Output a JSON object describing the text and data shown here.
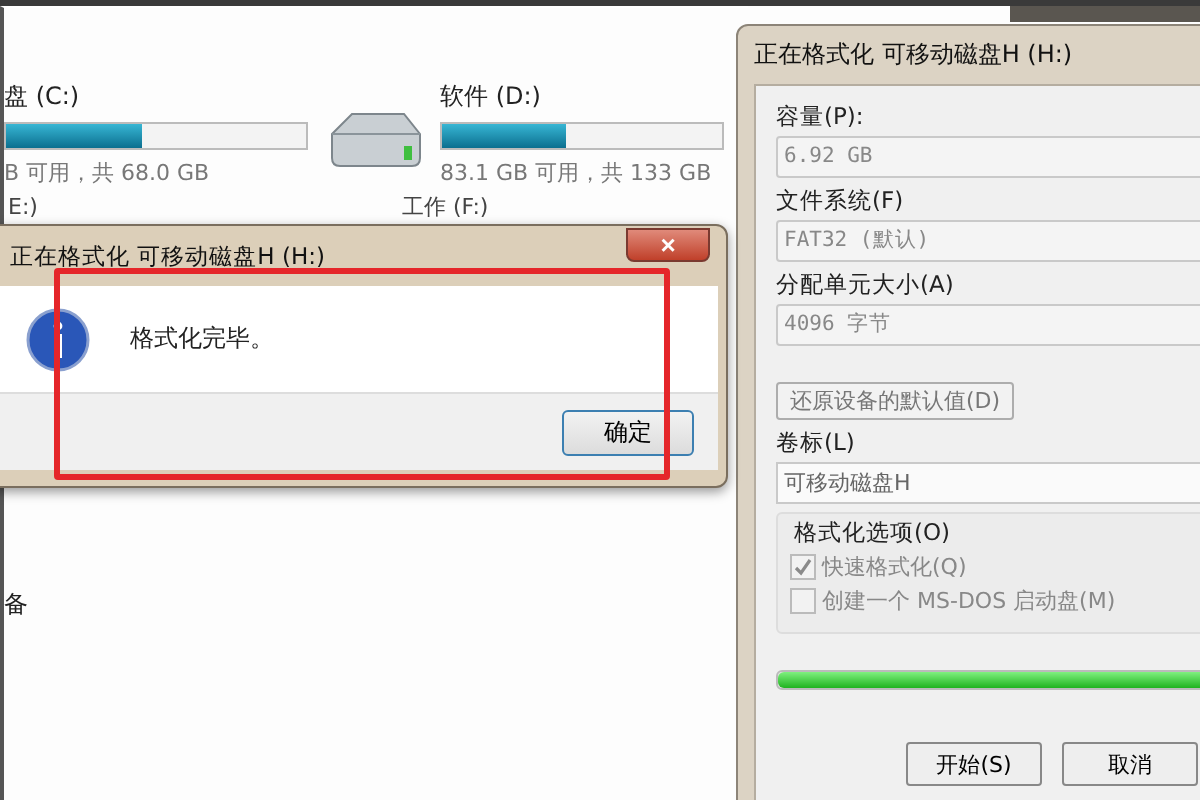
{
  "explorer": {
    "drives": [
      {
        "name": "盘 (C:)",
        "level": 0.45,
        "info": "B 可用，共 68.0 GB",
        "icon": false
      },
      {
        "name": "软件 (D:)",
        "level": 0.44,
        "info": "83.1 GB 可用，共 133 GB",
        "icon": true
      }
    ],
    "partial_labels": [
      "E:)",
      "工作 (F:)"
    ],
    "side_label": "备"
  },
  "message_box": {
    "title": "正在格式化 可移动磁盘H (H:)",
    "close": "×",
    "message": "格式化完毕。",
    "button": "确定",
    "highlighted": true
  },
  "format_dialog": {
    "title": "正在格式化 可移动磁盘H (H:)",
    "fields": [
      {
        "label": "容量(P):",
        "value": "6.92 GB",
        "disabled": true
      },
      {
        "label": "文件系统(F)",
        "value": "FAT32 (默认)",
        "disabled": true
      },
      {
        "label": "分配单元大小(A)",
        "value": "4096 字节",
        "disabled": true
      }
    ],
    "restore_button": "还原设备的默认值(D)",
    "volume": {
      "label": "卷标(L)",
      "value": "可移动磁盘H"
    },
    "options": {
      "legend": "格式化选项(O)",
      "items": [
        {
          "label": "快速格式化(Q)",
          "checked": true,
          "disabled": true
        },
        {
          "label": "创建一个 MS-DOS 启动盘(M)",
          "checked": false,
          "disabled": true
        }
      ]
    },
    "progress": {
      "level": 1.0
    },
    "buttons": [
      "开始(S)",
      "取消"
    ]
  }
}
